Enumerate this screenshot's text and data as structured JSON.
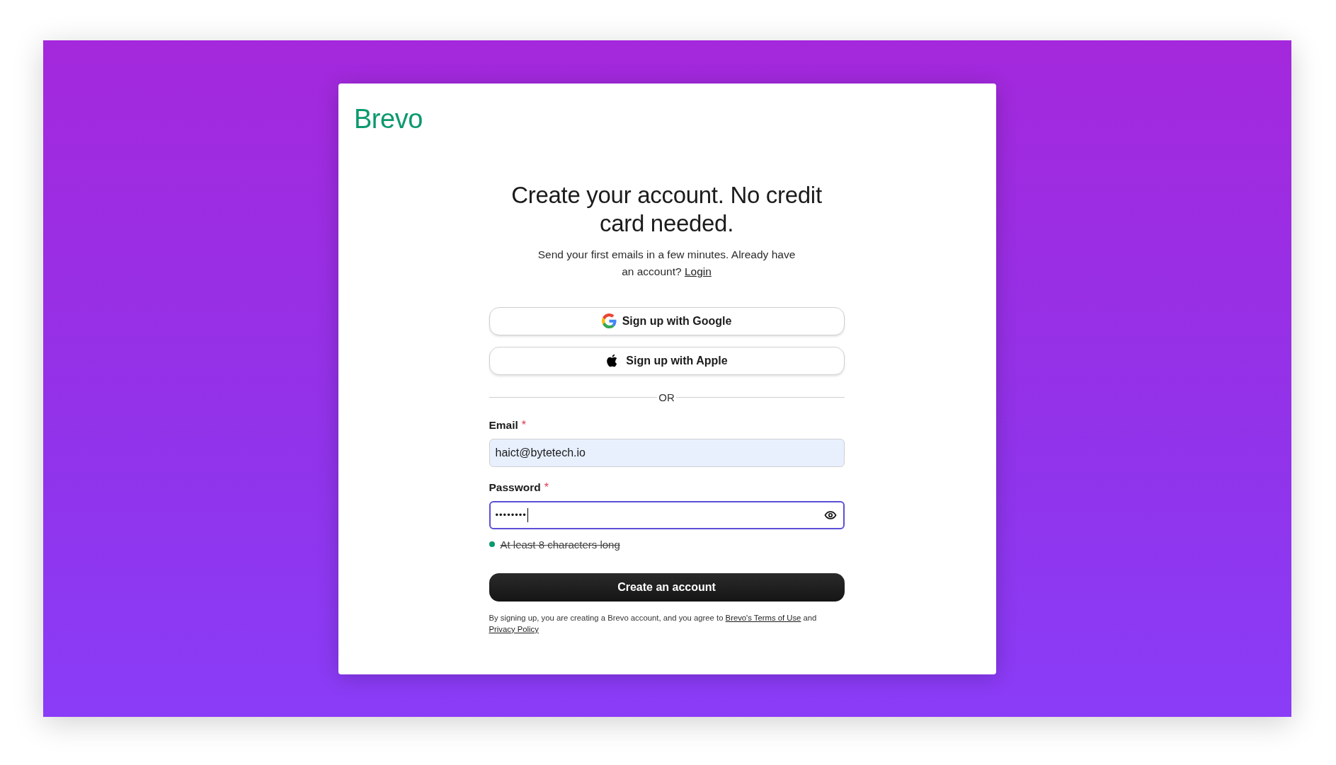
{
  "logo": "Brevo",
  "heading": "Create your account. No credit card needed.",
  "subtitle": {
    "text": "Send your first emails in a few minutes. Already have an account?",
    "link": "Login"
  },
  "social_buttons": [
    {
      "kind": "google",
      "label": "Sign up with Google"
    },
    {
      "kind": "apple",
      "label": "Sign up with Apple"
    }
  ],
  "divider": "OR",
  "required_mark": "*",
  "fields": [
    {
      "kind": "email",
      "label": "Email",
      "required": true,
      "value": "haict@bytetech.io",
      "focused": false,
      "autofilled": true
    },
    {
      "kind": "password",
      "label": "Password",
      "required": true,
      "value": "••••••••",
      "focused": true,
      "autofilled": false
    }
  ],
  "password_rules": [
    {
      "text": "At least 8 characters long",
      "met": true
    }
  ],
  "submit": "Create an account",
  "legal": {
    "text": "By signing up, you are creating a Brevo account, and you agree to",
    "terms_link": "Brevo's Terms of Use",
    "joiner": "and",
    "privacy_link": "Privacy Policy"
  }
}
